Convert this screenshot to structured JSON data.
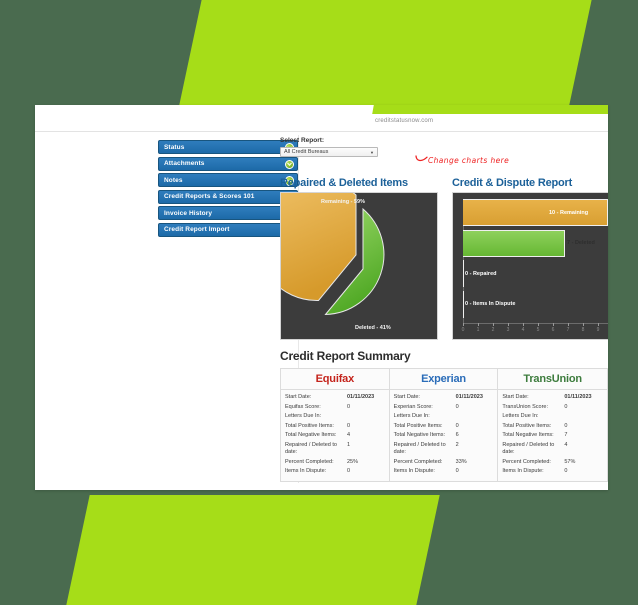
{
  "background": {
    "page_color": "#4a6b4f",
    "accent_green": "#a6dd18"
  },
  "browser": {
    "url": "creditstatusnow.com"
  },
  "sidebar": {
    "items": [
      {
        "label": "Status",
        "icon": "chevron-down-icon"
      },
      {
        "label": "Attachments",
        "icon": "chevron-down-icon"
      },
      {
        "label": "Notes",
        "icon": "chevron-down-icon"
      },
      {
        "label": "Credit Reports & Scores 101",
        "icon": "chevron-down-icon"
      },
      {
        "label": "Invoice History",
        "icon": "chevron-down-icon"
      },
      {
        "label": "Credit Report Import",
        "icon": "chevron-down-icon"
      }
    ]
  },
  "toolbar": {
    "select_report_label": "Select Report:",
    "report_selected": "All Credit Bureaus",
    "report_options": [
      "All Credit Bureaus"
    ],
    "dropdown_arrow_icon": "chevron-down-icon"
  },
  "annotation": {
    "text": "Change charts here",
    "color": "#ee2222",
    "icon": "curved-arrow-icon"
  },
  "chart_data": [
    {
      "type": "pie",
      "title": "Repaired & Deleted Items",
      "labels": [
        "Remaining - 59%",
        "Deleted - 41%"
      ],
      "categories": [
        "Remaining",
        "Deleted"
      ],
      "values": [
        59,
        41
      ],
      "colors": [
        "#e8b249",
        "#7bc84a"
      ],
      "plot_background": "#3c3c3c",
      "exploded": true,
      "legend": "none",
      "grid": false
    },
    {
      "type": "bar",
      "orientation": "horizontal",
      "title": "Credit & Dispute Report",
      "categories": [
        "Remaining",
        "Deleted",
        "Repaired",
        "Items In Dispute"
      ],
      "values": [
        10,
        7,
        0,
        0
      ],
      "bar_labels": [
        "10 - Remaining",
        "7 - Deleted",
        "0 - Repaired",
        "0 - Items In Dispute"
      ],
      "colors": [
        "#e8b249",
        "#7bc84a",
        "#3c3c3c",
        "#3c3c3c"
      ],
      "xlabel": "",
      "ylabel": "",
      "xlim": [
        0,
        10
      ],
      "xticks": [
        "0",
        "1",
        "2",
        "3",
        "4",
        "5",
        "6",
        "7",
        "8",
        "9"
      ],
      "plot_background": "#3c3c3c",
      "grid": false,
      "legend": "none"
    }
  ],
  "summary": {
    "title": "Credit Report Summary",
    "columns": [
      {
        "bureau": "Equifax",
        "color": "#c4241c",
        "rows": [
          {
            "label": "Start Date:",
            "value": "01/11/2023",
            "bold": true
          },
          {
            "label": "Equifax Score:",
            "value": "0",
            "bold": false
          },
          {
            "label": "Letters Due In:",
            "value": "",
            "bold": false
          },
          {
            "label": "Total Positive Items:",
            "value": "0",
            "bold": false
          },
          {
            "label": "Total Negative Items:",
            "value": "4",
            "bold": false
          },
          {
            "label": "Repaired / Deleted to date:",
            "value": "1",
            "bold": false
          },
          {
            "label": "Percent Completed:",
            "value": "25%",
            "bold": false
          },
          {
            "label": "Items In Dispute:",
            "value": "0",
            "bold": false
          }
        ]
      },
      {
        "bureau": "Experian",
        "color": "#2a6cb8",
        "rows": [
          {
            "label": "Start Date:",
            "value": "01/11/2023",
            "bold": true
          },
          {
            "label": "Experian Score:",
            "value": "0",
            "bold": false
          },
          {
            "label": "Letters Due In:",
            "value": "",
            "bold": false
          },
          {
            "label": "Total Positive Items:",
            "value": "0",
            "bold": false
          },
          {
            "label": "Total Negative Items:",
            "value": "6",
            "bold": false
          },
          {
            "label": "Repaired / Deleted to date:",
            "value": "2",
            "bold": false
          },
          {
            "label": "Percent Completed:",
            "value": "33%",
            "bold": false
          },
          {
            "label": "Items In Dispute:",
            "value": "0",
            "bold": false
          }
        ]
      },
      {
        "bureau": "TransUnion",
        "color": "#3d7c3d",
        "rows": [
          {
            "label": "Start Date:",
            "value": "01/11/2023",
            "bold": true
          },
          {
            "label": "TransUnion Score:",
            "value": "0",
            "bold": false
          },
          {
            "label": "Letters Due In:",
            "value": "",
            "bold": false
          },
          {
            "label": "Total Positive Items:",
            "value": "0",
            "bold": false
          },
          {
            "label": "Total Negative Items:",
            "value": "7",
            "bold": false
          },
          {
            "label": "Repaired / Deleted to date:",
            "value": "4",
            "bold": false
          },
          {
            "label": "Percent Completed:",
            "value": "57%",
            "bold": false
          },
          {
            "label": "Items In Dispute:",
            "value": "0",
            "bold": false
          }
        ]
      }
    ]
  }
}
